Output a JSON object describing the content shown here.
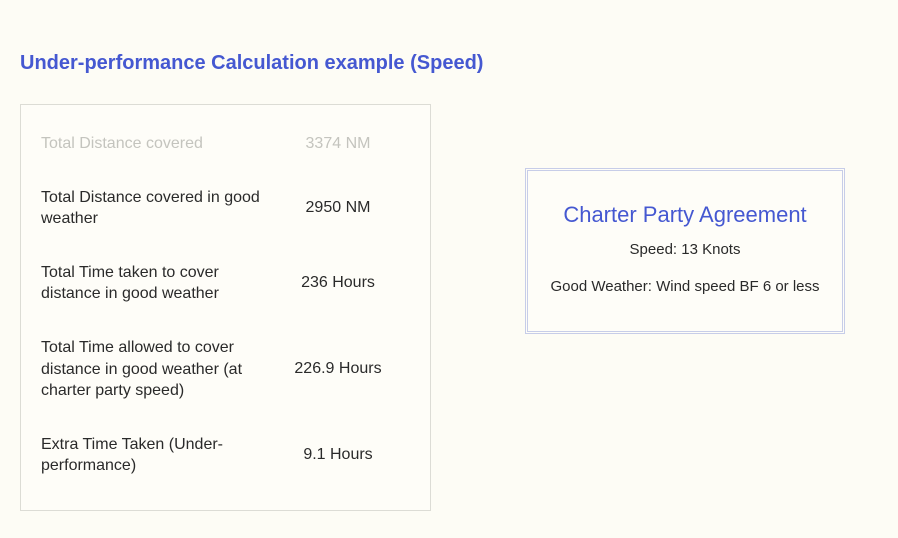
{
  "title": "Under-performance Calculation example (Speed)",
  "rows": [
    {
      "label": "Total Distance covered",
      "value": "3374 NM",
      "dim": true
    },
    {
      "label": "Total Distance covered in good weather",
      "value": "2950 NM",
      "dim": false
    },
    {
      "label": "Total Time taken to cover distance in good weather",
      "value": "236 Hours",
      "dim": false
    },
    {
      "label": "Total Time allowed to cover distance in good weather (at charter party speed)",
      "value": "226.9 Hours",
      "dim": false
    },
    {
      "label": "Extra Time Taken (Under-performance)",
      "value": "9.1 Hours",
      "dim": false
    }
  ],
  "agreement": {
    "title": "Charter Party Agreement",
    "speed_line": "Speed:  13 Knots",
    "weather_line": "Good Weather:  Wind speed BF 6 or less"
  }
}
